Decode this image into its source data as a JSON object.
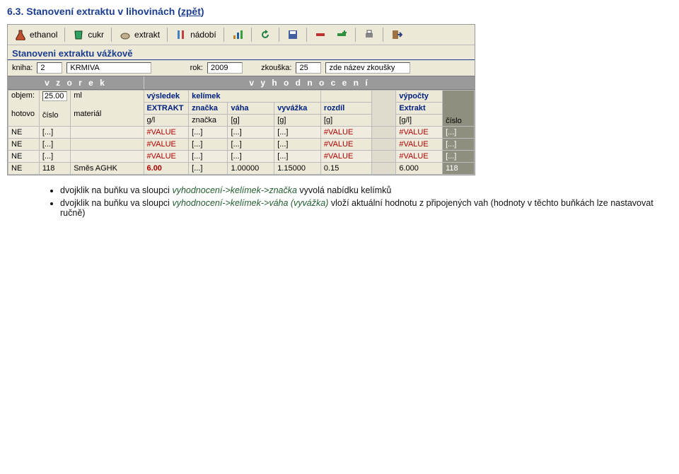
{
  "title_prefix": "6.3. Stanovení extraktu v lihovinách (",
  "title_link": "zpět",
  "title_suffix": ")",
  "toolbar": {
    "ethanol": "ethanol",
    "cukr": "cukr",
    "extrakt": "extrakt",
    "nadobi": "nádobí"
  },
  "section_title": "Stanoveni extraktu vážkově",
  "info": {
    "kniha_label": "kniha:",
    "kniha_num": "2",
    "kniha_name": "KRMIVA",
    "rok_label": "rok:",
    "rok": "2009",
    "zkouska_label": "zkouška:",
    "zkouska_num": "25",
    "zkouska_name": "zde název zkoušky"
  },
  "groups": {
    "vzorek": "v z o r e k",
    "vyhodnoceni": "v y h o d n o c e n í"
  },
  "objem": {
    "label": "objem:",
    "value": "25.00",
    "unit": "ml"
  },
  "sub": {
    "vysledek": "výsledek",
    "kelimek": "kelímek",
    "vypocty": "výpočty",
    "extrakt": "EXTRAKT",
    "znacka": "značka",
    "vaha": "váha",
    "vyvazka": "vyvážka",
    "rozdil": "rozdíl",
    "Extrakt": "Extrakt"
  },
  "head": {
    "hotovo": "hotovo",
    "cislo": "číslo",
    "material": "materiál",
    "gl": "g/l",
    "znacka": "značka",
    "g1": "[g]",
    "g2": "[g]",
    "g3": "[g]",
    "gpl": "[g/l]",
    "cislo2": "číslo"
  },
  "rows": [
    {
      "hot": "NE",
      "cislo": "[...]",
      "mat": "",
      "ext": "#VALUE",
      "zn": "[...]",
      "vaha": "[...]",
      "vyv": "[...]",
      "roz": "#VALUE",
      "extc": "#VALUE",
      "cis2": "[...]"
    },
    {
      "hot": "NE",
      "cislo": "[...]",
      "mat": "",
      "ext": "#VALUE",
      "zn": "[...]",
      "vaha": "[...]",
      "vyv": "[...]",
      "roz": "#VALUE",
      "extc": "#VALUE",
      "cis2": "[...]"
    },
    {
      "hot": "NE",
      "cislo": "[...]",
      "mat": "",
      "ext": "#VALUE",
      "zn": "[...]",
      "vaha": "[...]",
      "vyv": "[...]",
      "roz": "#VALUE",
      "extc": "#VALUE",
      "cis2": "[...]"
    },
    {
      "hot": "NE",
      "cislo": "118",
      "mat": "Směs AGHK",
      "ext": "6.00",
      "zn": "[...]",
      "vaha": "1.00000",
      "vyv": "1.15000",
      "roz": "0.15",
      "extc": "6.000",
      "cis2": "118"
    }
  ],
  "notes": {
    "n1a": "dvojklik na buňku va sloupci ",
    "n1b": "vyhodnocení->kelímek->značka",
    "n1c": " vyvolá nabídku kelímků",
    "n2a": "dvojklik na buňku va sloupci ",
    "n2b": "vyhodnocení->kelímek->váha (vyvážka)",
    "n2c": " vloží aktuální hodnotu z připojených vah (hodnoty v těchto buňkách lze nastavovat ručně)"
  }
}
